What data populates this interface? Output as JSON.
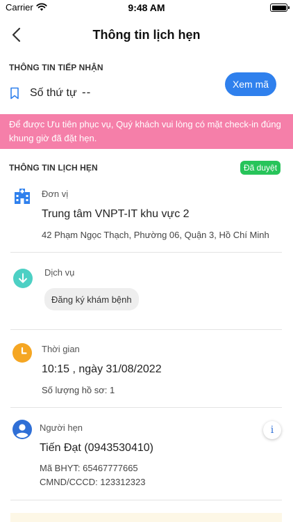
{
  "status_bar": {
    "carrier": "Carrier",
    "time": "9:48 AM"
  },
  "header": {
    "title": "Thông tin lịch hẹn"
  },
  "reception": {
    "section_title": "THÔNG TIN TIẾP NHẬN",
    "ticket_label": "Số thứ tự",
    "ticket_value": "--",
    "view_code_button": "Xem mã"
  },
  "notice": "Để được Ưu tiên phục vụ, Quý khách vui lòng có mặt check-in đúng khung giờ đã đặt hẹn.",
  "appointment": {
    "section_title": "THÔNG TIN LỊCH HẸN",
    "status": "Đã duyệt",
    "unit": {
      "label": "Đơn vị",
      "name": "Trung tâm VNPT-IT khu vực 2",
      "address": "42 Phạm Ngọc Thạch, Phường 06, Quận 3, Hồ Chí Minh"
    },
    "service": {
      "label": "Dịch vụ",
      "value": "Đăng ký khám bệnh"
    },
    "time": {
      "label": "Thời gian",
      "value": "10:15 , ngày 31/08/2022",
      "records": "Số lượng hồ sơ: 1"
    },
    "person": {
      "label": "Người hẹn",
      "name": "Tiến Đạt (0943530410)",
      "insurance": "Mã BHYT: 65467777665",
      "id_card": "CMND/CCCD: 123312323"
    }
  },
  "icons": {
    "back": "chevron-left-icon",
    "wifi": "wifi-icon",
    "battery": "battery-icon",
    "bookmark": "bookmark-icon",
    "unit": "building-icon",
    "service": "arrow-down-circle-icon",
    "time": "clock-icon",
    "person": "user-circle-icon",
    "info": "info-icon"
  },
  "colors": {
    "accent": "#2f80ed",
    "notice": "#f57fa9",
    "approved": "#27c45a",
    "service_icon": "#4dd0c4",
    "clock_icon": "#f5a623",
    "user_icon": "#2f6fd6"
  }
}
